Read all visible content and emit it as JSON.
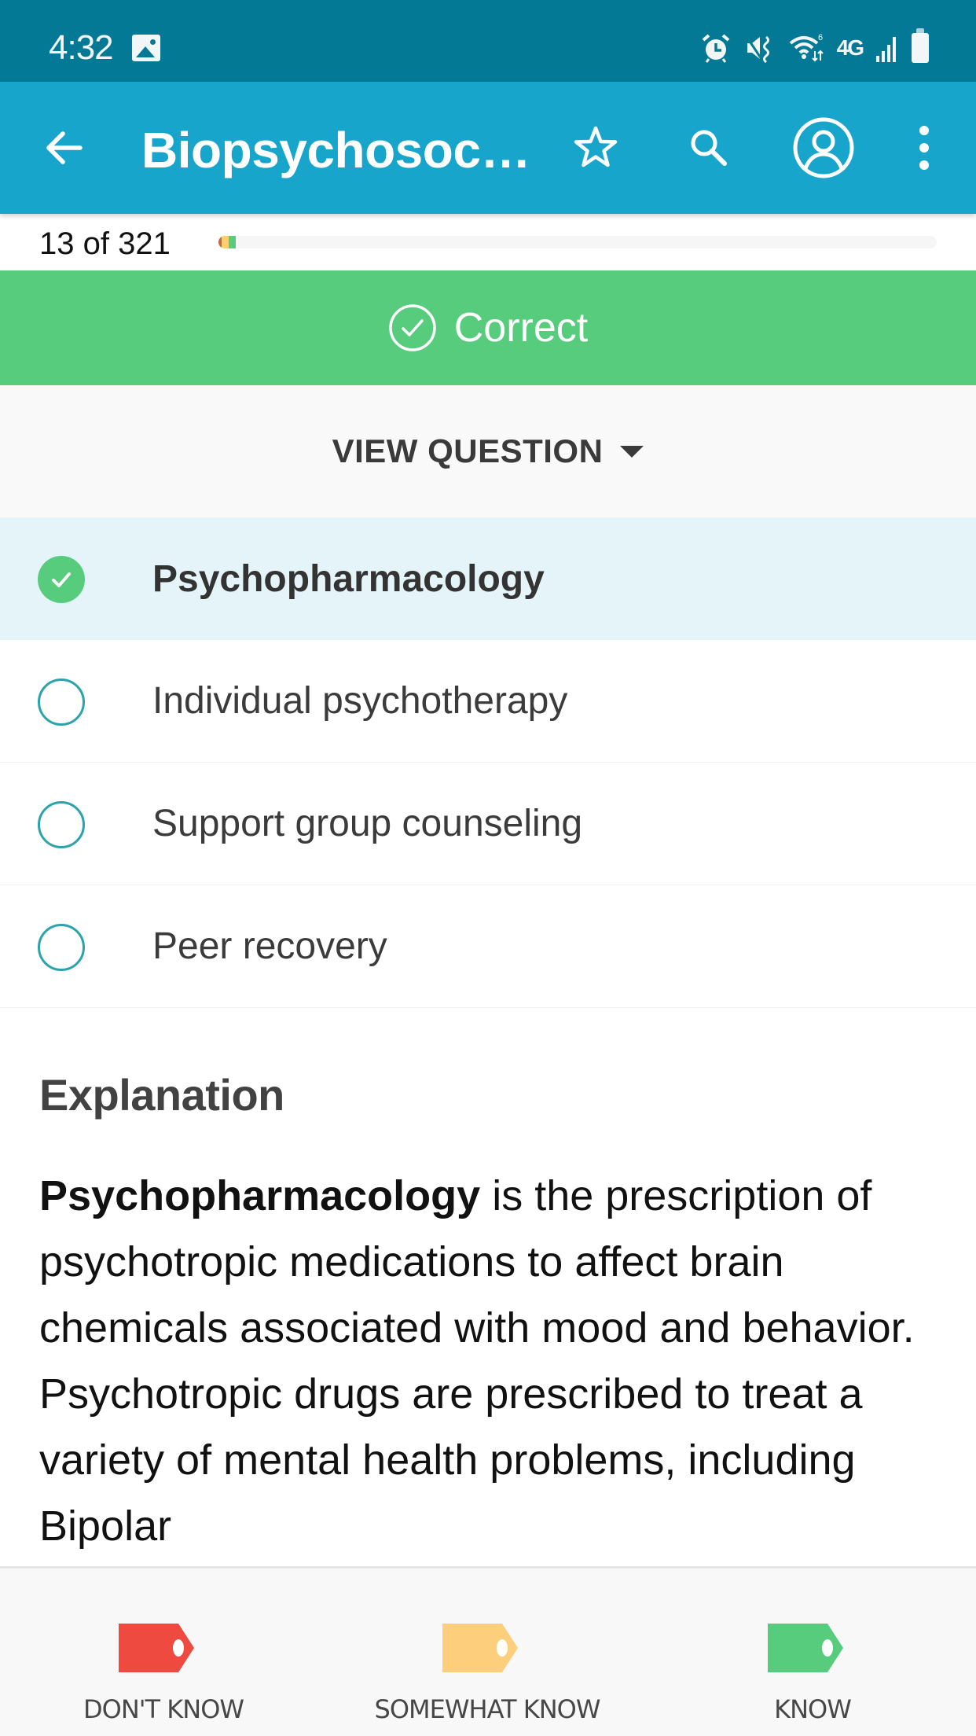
{
  "status_bar": {
    "time": "4:32",
    "icons": [
      "gallery-icon",
      "alarm-icon",
      "vibrate-mute-icon",
      "wifi-icon",
      "lte-icon",
      "signal-icon",
      "battery-icon"
    ],
    "network_label": "4G",
    "wifi_badge": "6"
  },
  "app_bar": {
    "title": "Biopsychosoc…",
    "icons": [
      "back-arrow-icon",
      "star-icon",
      "search-icon",
      "profile-icon",
      "more-vert-icon"
    ]
  },
  "progress": {
    "current": 13,
    "total": 321,
    "label": "13 of 321",
    "segments": [
      {
        "status": "dont_know",
        "color": "#c2683f",
        "fraction": 0.0031
      },
      {
        "status": "somewhat_know",
        "color": "#fdcf6f",
        "fraction": 0.0093
      },
      {
        "status": "know",
        "color": "#57cc7d",
        "fraction": 0.0093
      }
    ]
  },
  "result_banner": {
    "label": "Correct",
    "icon": "check-circle-icon",
    "color": "#57cc7d"
  },
  "view_question": {
    "label": "VIEW QUESTION",
    "icon": "caret-down-icon"
  },
  "answers": [
    {
      "text": "Psychopharmacology",
      "selected": true,
      "correct": true
    },
    {
      "text": "Individual psychotherapy",
      "selected": false,
      "correct": false
    },
    {
      "text": "Support group counseling",
      "selected": false,
      "correct": false
    },
    {
      "text": "Peer recovery",
      "selected": false,
      "correct": false
    }
  ],
  "explanation": {
    "title": "Explanation",
    "bold_term": "Psychopharmacology",
    "body": " is the prescription of psychotropic medications to affect brain chemicals associated with mood and behavior. Psychotropic drugs are prescribed to treat a variety of mental health problems, including Bipolar"
  },
  "bottom_bar": {
    "buttons": [
      {
        "label": "DON'T KNOW",
        "icon": "tag-icon",
        "color": "#ef4a3f"
      },
      {
        "label": "SOMEWHAT KNOW",
        "icon": "tag-icon",
        "color": "#fdcf7c"
      },
      {
        "label": "KNOW",
        "icon": "tag-icon",
        "color": "#57cc7d"
      }
    ]
  },
  "colors": {
    "status_bar": "#047996",
    "app_bar": "#17a5cb",
    "selected_row": "#e5f4f9",
    "radio_outline": "#2aa3ad"
  }
}
